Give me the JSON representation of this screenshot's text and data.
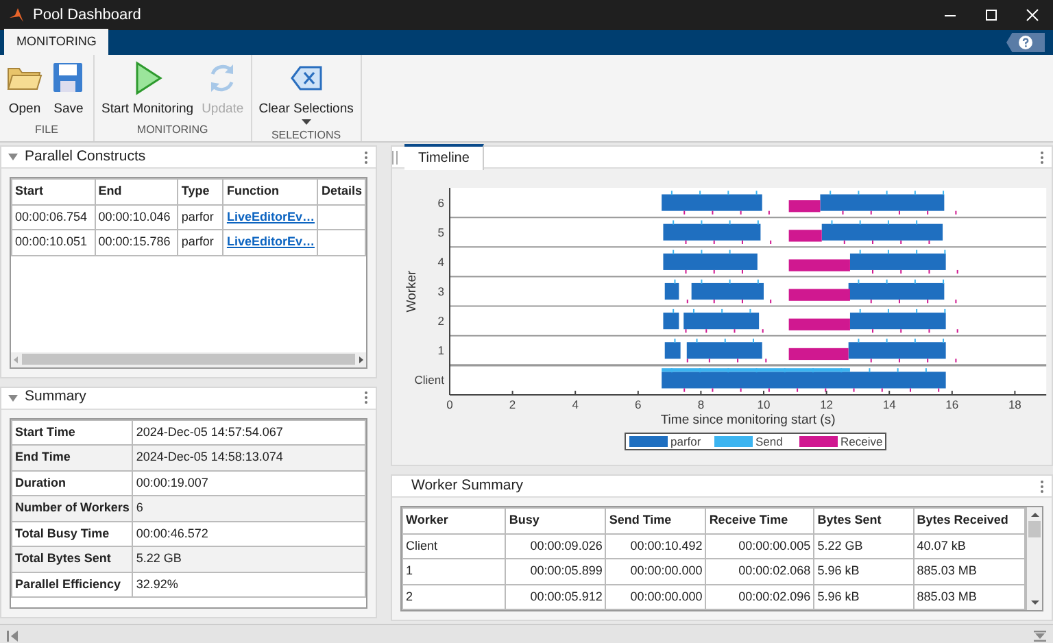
{
  "window": {
    "title": "Pool Dashboard"
  },
  "ribbon": {
    "tabs": [
      {
        "label": "MONITORING",
        "selected": true
      }
    ],
    "sections": [
      {
        "title": "FILE",
        "buttons": [
          {
            "kind": "open",
            "label": "Open",
            "disabled": false,
            "dropdown": false
          },
          {
            "kind": "save",
            "label": "Save",
            "disabled": false,
            "dropdown": false
          }
        ]
      },
      {
        "title": "MONITORING",
        "buttons": [
          {
            "kind": "play",
            "label": "Start Monitoring",
            "disabled": false,
            "dropdown": false
          },
          {
            "kind": "refresh",
            "label": "Update",
            "disabled": true,
            "dropdown": false
          }
        ]
      },
      {
        "title": "SELECTIONS",
        "buttons": [
          {
            "kind": "clear",
            "label": "Clear Selections",
            "disabled": false,
            "dropdown": true
          }
        ]
      }
    ]
  },
  "parallel_constructs": {
    "title": "Parallel Constructs",
    "expanded": true,
    "columns": [
      {
        "label": "Start",
        "kind": "text"
      },
      {
        "label": "End",
        "kind": "text"
      },
      {
        "label": "Type",
        "kind": "text"
      },
      {
        "label": "Function",
        "kind": "link"
      },
      {
        "label": "Details",
        "kind": "text"
      }
    ],
    "rows": [
      [
        "00:00:06.754",
        "00:00:10.046",
        "parfor",
        "LiveEditorEv…",
        ""
      ],
      [
        "00:00:10.051",
        "00:00:15.786",
        "parfor",
        "LiveEditorEv…",
        ""
      ]
    ]
  },
  "summary": {
    "title": "Summary",
    "expanded": true,
    "rows": [
      {
        "label": "Start Time",
        "value": "2024-Dec-05 14:57:54.067"
      },
      {
        "label": "End Time",
        "value": "2024-Dec-05 14:58:13.074"
      },
      {
        "label": "Duration",
        "value": "00:00:19.007"
      },
      {
        "label": "Number of Workers",
        "value": "6"
      },
      {
        "label": "Total Busy Time",
        "value": "00:00:46.572"
      },
      {
        "label": "Total Bytes Sent",
        "value": "5.22 GB"
      },
      {
        "label": "Parallel Efficiency",
        "value": "32.92%"
      }
    ]
  },
  "timeline": {
    "tabs": [
      {
        "label": "Timeline",
        "selected": true
      }
    ],
    "xlabel": "Time since monitoring start (s)",
    "ylabel": "Worker",
    "worker_labels": [
      "6",
      "5",
      "4",
      "3",
      "2",
      "1",
      "Client"
    ],
    "x_tick_labels": [
      "0",
      "2",
      "4",
      "6",
      "8",
      "10",
      "12",
      "14",
      "16",
      "18"
    ],
    "legend": [
      {
        "label": "parfor",
        "color": "#1f6fc0"
      },
      {
        "label": "Send",
        "color": "#3cb4f0"
      },
      {
        "label": "Receive",
        "color": "#d01890"
      }
    ]
  },
  "worker_summary": {
    "title": "Worker Summary",
    "columns": [
      "Worker",
      "Busy",
      "Send Time",
      "Receive Time",
      "Bytes Sent",
      "Bytes Received"
    ],
    "rows": [
      [
        "Client",
        "00:00:09.026",
        "00:00:10.492",
        "00:00:00.005",
        "5.22 GB",
        "40.07 kB"
      ],
      [
        "1",
        "00:00:05.899",
        "00:00:00.000",
        "00:00:02.068",
        "5.96 kB",
        "885.03 MB"
      ],
      [
        "2",
        "00:00:05.912",
        "00:00:00.000",
        "00:00:02.096",
        "5.96 kB",
        "885.03 MB"
      ]
    ]
  }
}
